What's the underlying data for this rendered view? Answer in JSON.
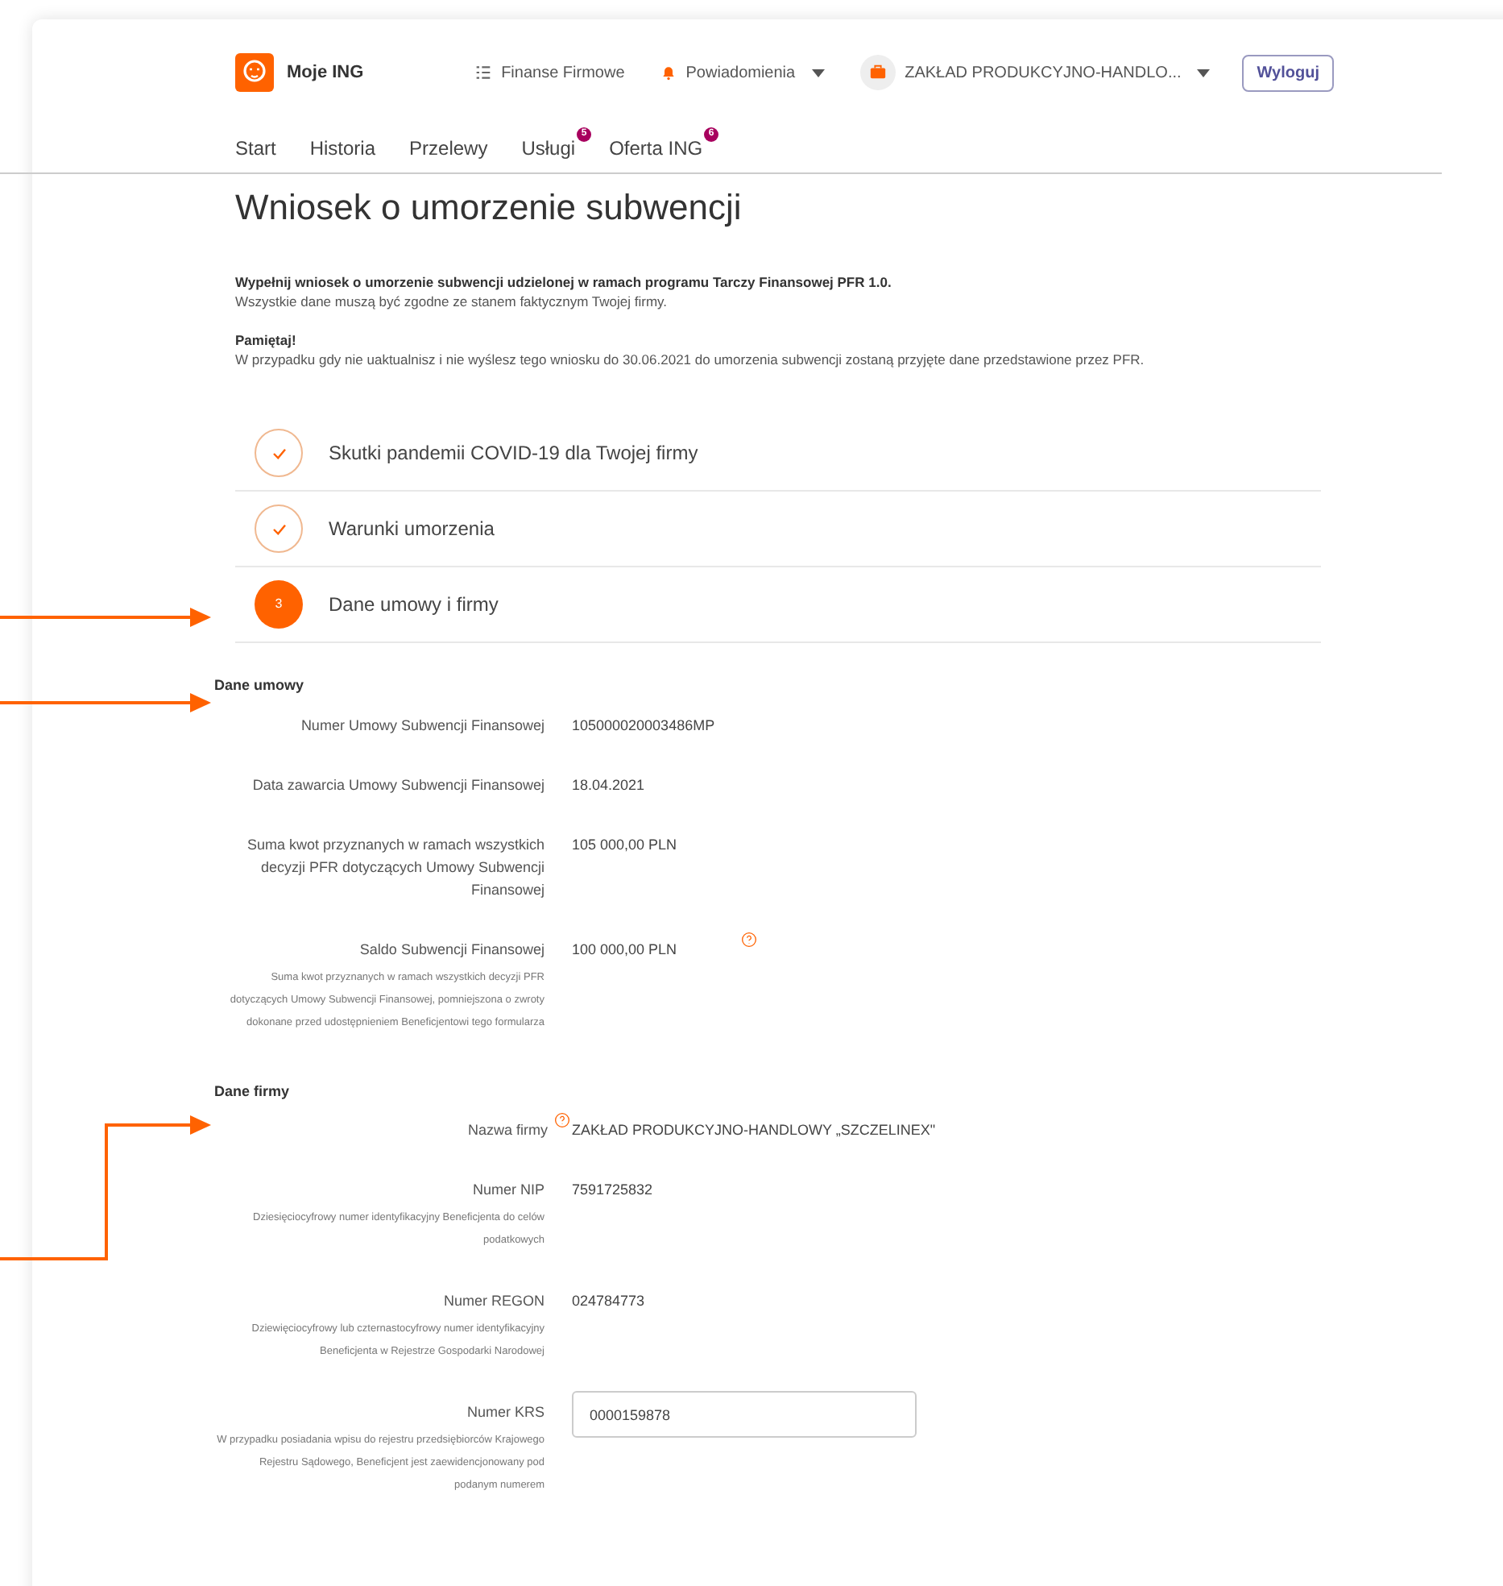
{
  "header": {
    "brand": "Moje ING",
    "nav_links": [
      {
        "kind": "menu",
        "label": "Finanse Firmowe"
      },
      {
        "kind": "bell",
        "label": "Powiadomienia"
      },
      {
        "kind": "company",
        "label": "ZAKŁAD PRODUKCYJNO-HANDLO..."
      }
    ],
    "logout": "Wyloguj"
  },
  "tabs": [
    {
      "label": "Start"
    },
    {
      "label": "Historia"
    },
    {
      "label": "Przelewy"
    },
    {
      "label": "Usługi",
      "badge": "5"
    },
    {
      "label": "Oferta ING",
      "badge": "6"
    }
  ],
  "title": "Wniosek o umorzenie subwencji",
  "intro": {
    "lead": "Wypełnij wniosek o umorzenie subwencji udzielonej w ramach programu Tarczy Finansowej PFR 1.0.",
    "text": "Wszystkie dane muszą być zgodne ze stanem faktycznym Twojej firmy.",
    "note_title": "Pamiętaj!",
    "note": "W przypadku gdy nie uaktualnisz i nie wyślesz tego wniosku do 30.06.2021 do umorzenia subwencji zostaną przyjęte dane przedstawione przez PFR."
  },
  "steps": [
    {
      "kind": "done",
      "label": "Skutki pandemii COVID-19 dla Twojej firmy"
    },
    {
      "kind": "done",
      "label": "Warunki umorzenia"
    },
    {
      "kind": "current",
      "number": "3",
      "label": "Dane umowy i firmy"
    }
  ],
  "sections": [
    {
      "heading": "Dane umowy",
      "fields": [
        {
          "kind": "text",
          "label": "Numer Umowy Subwencji Finansowej",
          "value": "105000020003486MP"
        },
        {
          "kind": "text",
          "label": "Data zawarcia Umowy Subwencji Finansowej",
          "value": "18.04.2021"
        },
        {
          "kind": "text",
          "label": "Suma kwot przyznanych w ramach wszystkich decyzji PFR dotyczących Umowy Subwencji Finansowej",
          "value": "105 000,00 PLN"
        },
        {
          "kind": "text",
          "label": "Saldo Subwencji Finansowej",
          "value": "100 000,00 PLN",
          "help_by_value": true,
          "description": "Suma kwot przyznanych w ramach wszystkich decyzji PFR dotyczących Umowy Subwencji Finansowej, pomniejszona o zwroty dokonane przed udostępnieniem Beneficjentowi tego formularza"
        }
      ]
    },
    {
      "heading": "Dane firmy",
      "fields": [
        {
          "kind": "text",
          "label": "Nazwa firmy",
          "value": "ZAKŁAD PRODUKCYJNO-HANDLOWY „SZCZELINEX\"",
          "help_by_label": true
        },
        {
          "kind": "text",
          "label": "Numer NIP",
          "value": "7591725832",
          "description": "Dziesięciocyfrowy numer identyfikacyjny Beneficjenta do celów podatkowych"
        },
        {
          "kind": "text",
          "label": "Numer REGON",
          "value": "024784773",
          "description": "Dziewięciocyfrowy lub czternastocyfrowy numer identyfikacyjny Beneficjenta w Rejestrze Gospodarki Narodowej"
        },
        {
          "kind": "input",
          "label": "Numer KRS",
          "value": "0000159878",
          "description": "W przypadku posiadania wpisu do rejestru przedsiębiorców Krajowego Rejestru Sądowego, Beneficjent jest zaewidencjonowany pod podanym numerem"
        }
      ]
    }
  ]
}
